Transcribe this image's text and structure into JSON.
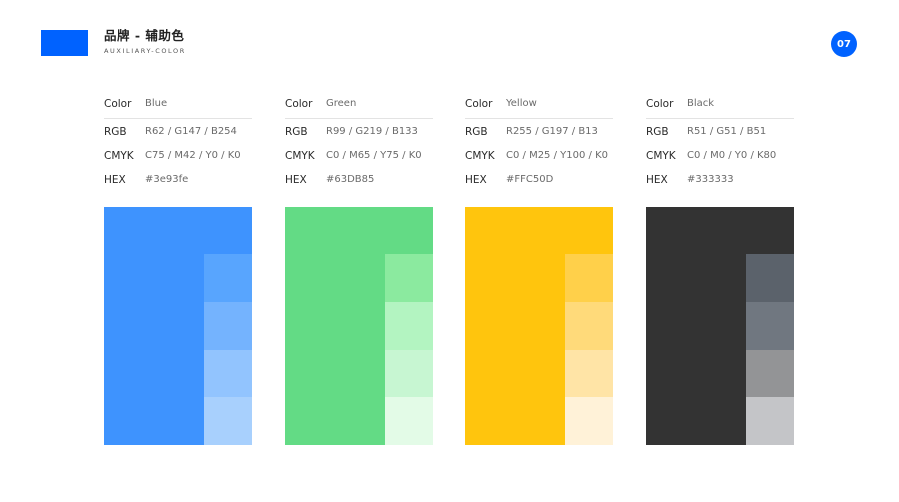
{
  "header": {
    "title": "品牌 - 辅助色",
    "subtitle": "AUXILIARY-COLOR",
    "page_number": "07",
    "accent_color": "#0062ff"
  },
  "labels": {
    "color": "Color",
    "rgb": "RGB",
    "cmyk": "CMYK",
    "hex": "HEX"
  },
  "colors": [
    {
      "name": "Blue",
      "rgb": "R62 / G147 / B254",
      "cmyk": "C75 / M42 / Y0 / K0",
      "hex": "#3e93fe",
      "swatch": "#3e93fe",
      "tints": [
        "#58a5fe",
        "#74b3fe",
        "#92c4fe",
        "#a8d0fd"
      ]
    },
    {
      "name": "Green",
      "rgb": "R99 / G219 / B133",
      "cmyk": "C0 / M65 / Y75 / K0",
      "hex": "#63DB85",
      "swatch": "#63db85",
      "tints": [
        "#8bea9f",
        "#b3f4c1",
        "#c7f6d2",
        "#e3fbe7"
      ]
    },
    {
      "name": "Yellow",
      "rgb": "R255 / G197 / B13",
      "cmyk": "C0 / M25 / Y100 / K0",
      "hex": "#FFC50D",
      "swatch": "#ffc50d",
      "tints": [
        "#ffd04a",
        "#ffda7a",
        "#ffe4a6",
        "#fff2d8"
      ]
    },
    {
      "name": "Black",
      "rgb": "R51 / G51 / B51",
      "cmyk": "C0 / M0 / Y0 / K80",
      "hex": "#333333",
      "swatch": "#333333",
      "tints": [
        "#5b626b",
        "#707780",
        "#939496",
        "#c4c5c8"
      ]
    }
  ]
}
